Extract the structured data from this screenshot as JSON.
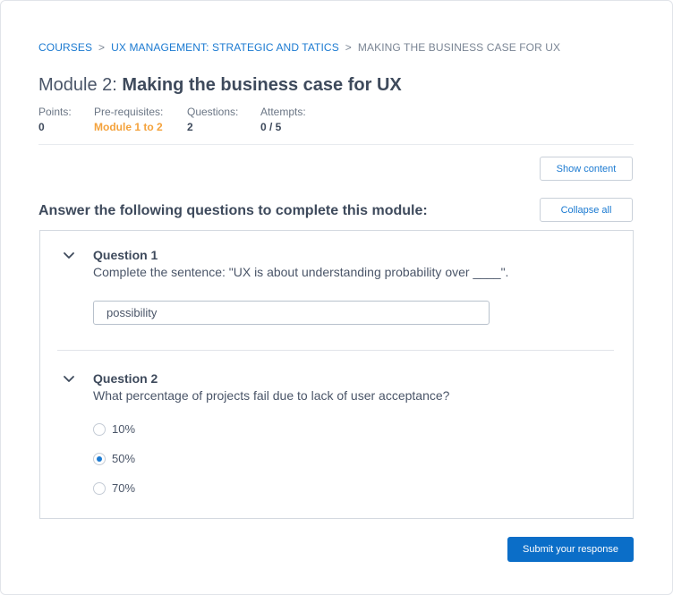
{
  "breadcrumb": {
    "items": [
      "COURSES",
      "UX MANAGEMENT: STRATEGIC AND TATICS"
    ],
    "current": "MAKING THE BUSINESS CASE FOR UX",
    "separator": ">"
  },
  "title": {
    "prefix": "Module 2:",
    "name": "Making the business case for UX"
  },
  "meta": {
    "points": {
      "label": "Points:",
      "value": "0"
    },
    "prerequisites": {
      "label": "Pre-requisites:",
      "value": "Module 1 to 2"
    },
    "questions": {
      "label": "Questions:",
      "value": "2"
    },
    "attempts": {
      "label": "Attempts:",
      "value": "0 / 5"
    }
  },
  "buttons": {
    "show_content": "Show content",
    "collapse_all": "Collapse  all",
    "submit": "Submit your response"
  },
  "section_heading": "Answer the following questions to complete this module:",
  "questions": [
    {
      "title": "Question 1",
      "text": "Complete the sentence: \"UX is about understanding probability over ____\".",
      "answer": "possibility"
    },
    {
      "title": "Question 2",
      "text": "What percentage of projects fail due to lack of user acceptance?",
      "options": [
        "10%",
        "50%",
        "70%"
      ],
      "selected": "50%"
    }
  ],
  "colors": {
    "link": "#1b7ad1",
    "accent_orange": "#f4a23c",
    "primary_button": "#0b6ec8"
  },
  "icons": {
    "expand": "chevron-down-icon"
  }
}
